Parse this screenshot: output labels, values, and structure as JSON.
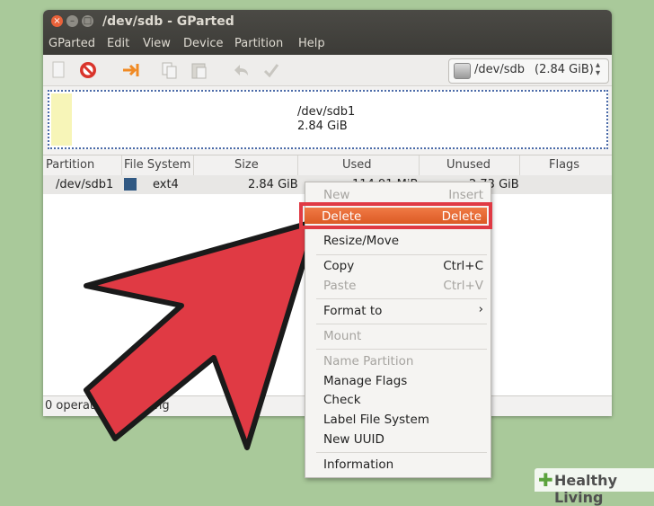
{
  "window": {
    "title": "/dev/sdb - GParted",
    "controls": {
      "close": "×",
      "minimize": "–",
      "maximize": "□"
    }
  },
  "menubar": [
    "GParted",
    "Edit",
    "View",
    "Device",
    "Partition",
    "Help"
  ],
  "toolbar": {
    "icons": [
      "new-icon",
      "delete-icon",
      "resize-move-icon",
      "copy-icon",
      "paste-icon",
      "undo-icon",
      "apply-icon"
    ],
    "device_selector": {
      "name": "/dev/sdb",
      "size": "(2.84 GiB)"
    }
  },
  "diskmap": {
    "partition": "/dev/sdb1",
    "size": "2.84 GiB"
  },
  "table": {
    "headers": [
      "Partition",
      "File System",
      "Size",
      "Used",
      "Unused",
      "Flags"
    ],
    "rows": [
      {
        "partition": "/dev/sdb1",
        "filesystem": "ext4",
        "fs_color": "#315983",
        "size": "2.84 GiB",
        "used": "114.91 MiB",
        "unused": "2.73 GiB",
        "flags": ""
      }
    ]
  },
  "statusbar": {
    "text": "0 operations pending"
  },
  "context_menu": {
    "items": [
      {
        "label": "New",
        "accel": "Insert",
        "enabled": false
      },
      {
        "label": "Delete",
        "accel": "Delete",
        "enabled": true,
        "highlighted": true
      },
      {
        "label": "Resize/Move",
        "accel": "",
        "enabled": true
      },
      {
        "label": "Copy",
        "accel": "Ctrl+C",
        "enabled": true
      },
      {
        "label": "Paste",
        "accel": "Ctrl+V",
        "enabled": false
      },
      {
        "label": "Format to",
        "accel": "›",
        "enabled": true
      },
      {
        "label": "Mount",
        "accel": "",
        "enabled": false
      },
      {
        "label": "Name Partition",
        "accel": "",
        "enabled": false
      },
      {
        "label": "Manage Flags",
        "accel": "",
        "enabled": true
      },
      {
        "label": "Check",
        "accel": "",
        "enabled": true
      },
      {
        "label": "Label File System",
        "accel": "",
        "enabled": true
      },
      {
        "label": "New UUID",
        "accel": "",
        "enabled": true
      },
      {
        "label": "Information",
        "accel": "",
        "enabled": true
      }
    ]
  },
  "annotation": {
    "arrow_color": "#e03a44",
    "highlight_color": "#e03a44"
  },
  "watermark": {
    "text": "Healthy Living"
  }
}
